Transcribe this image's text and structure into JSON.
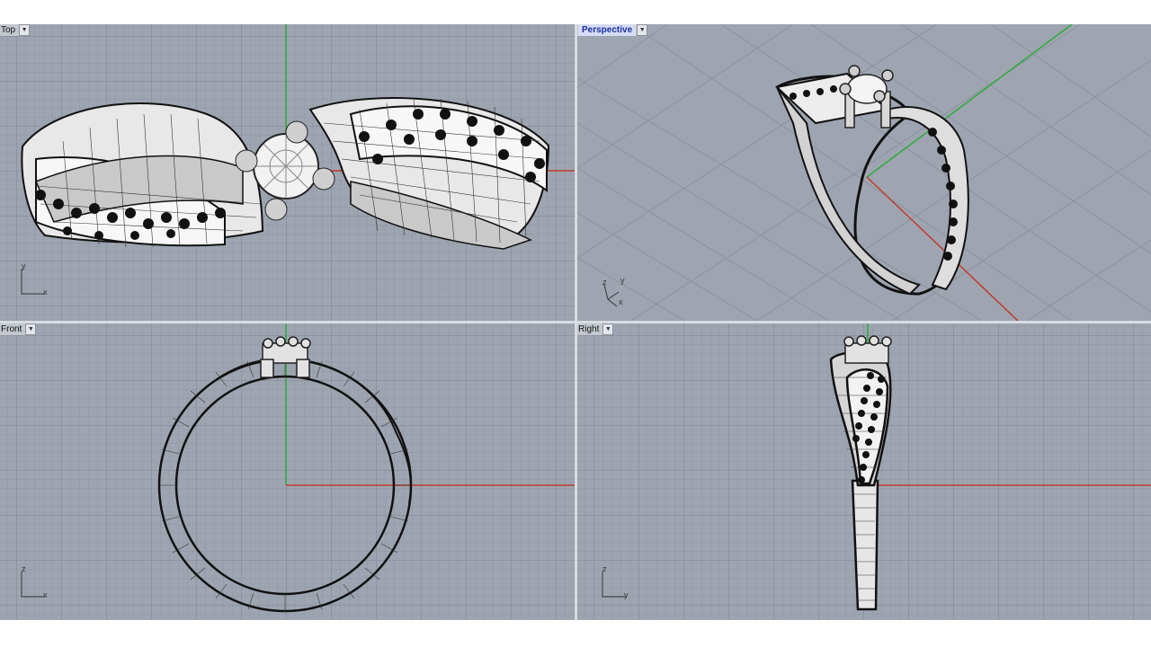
{
  "viewports": {
    "top": {
      "label": "Top",
      "axis_a": "y",
      "axis_b": "x"
    },
    "perspective": {
      "label": "Perspective",
      "axis_a": "z",
      "axis_b": "y",
      "axis_c": "x"
    },
    "front": {
      "label": "Front",
      "axis_a": "z",
      "axis_b": "x"
    },
    "right": {
      "label": "Right",
      "axis_a": "z",
      "axis_b": "y"
    }
  },
  "colors": {
    "viewport_bg": "#9ea5b0",
    "grid_minor": "#8f96a2",
    "grid_major": "#7d8490",
    "x_axis": "#c0392b",
    "y_axis": "#2faa3c",
    "active_label_bg": "#d6dcf5"
  },
  "icons": {
    "viewport_menu": "chevron-down-icon"
  }
}
